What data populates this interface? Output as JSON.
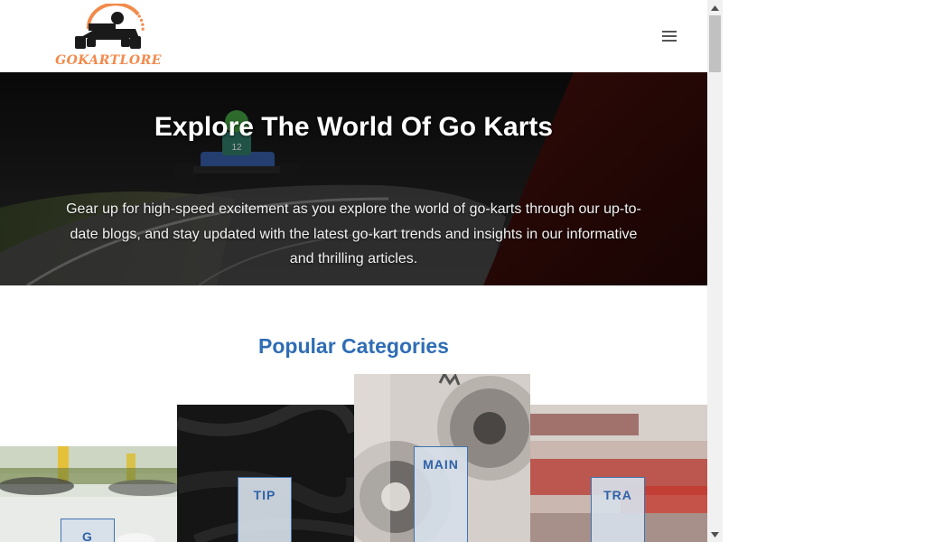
{
  "header": {
    "logo_text": "GOKARTLORE",
    "menu_icon": "hamburger-menu-icon"
  },
  "hero": {
    "title": "Explore The World Of Go Karts",
    "description": "Gear up for high-speed excitement as you explore the world of go-karts through our up-to-date blogs, and stay updated with the latest go-kart trends and insights in our informative and thrilling articles."
  },
  "categories": {
    "title": "Popular Categories",
    "items": [
      {
        "label": "G"
      },
      {
        "label": "TIP"
      },
      {
        "label": "MAIN"
      },
      {
        "label": "TRA"
      }
    ]
  },
  "colors": {
    "accent_blue": "#2f6db5",
    "logo_orange": "#f28a4b"
  }
}
